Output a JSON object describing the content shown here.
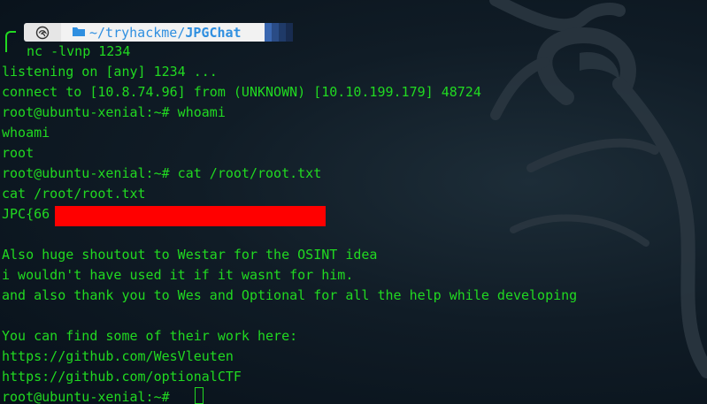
{
  "prompt": {
    "icon": "kali-dragon-icon",
    "path_prefix": "~/tryhackme/",
    "path_dir": "JPGChat",
    "command": "nc -lvnp 1234"
  },
  "terminal": {
    "lines": [
      "listening on [any] 1234 ...",
      "connect to [10.8.74.96] from (UNKNOWN) [10.10.199.179] 48724",
      "root@ubuntu-xenial:~# whoami",
      "whoami",
      "root",
      "root@ubuntu-xenial:~# cat /root/root.txt",
      "cat /root/root.txt",
      "JPC{66",
      "",
      "Also huge shoutout to Westar for the OSINT idea",
      "i wouldn't have used it if it wasnt for him.",
      "and also thank you to Wes and Optional for all the help while developing",
      "",
      "You can find some of their work here:",
      "https://github.com/WesVleuten",
      "https://github.com/optionalCTF",
      "root@ubuntu-xenial:~# "
    ]
  },
  "colors": {
    "text": "#21d921",
    "redaction": "#ff0000",
    "path": "#2f8fe0",
    "background": "#0b1620"
  }
}
